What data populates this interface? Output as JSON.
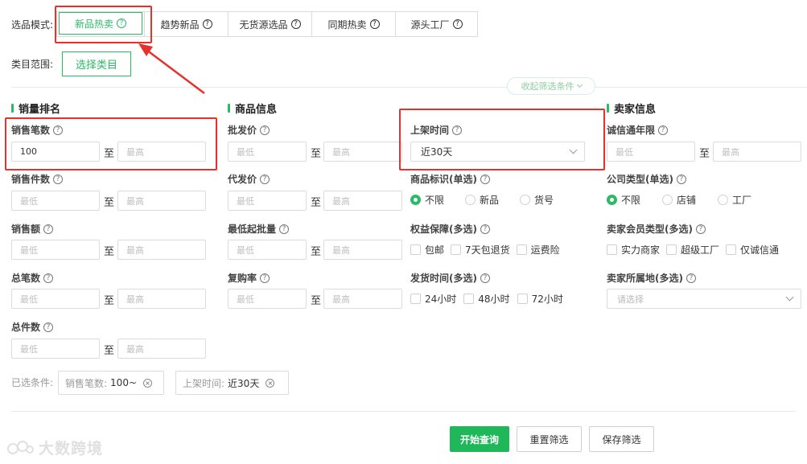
{
  "mode": {
    "label": "选品模式:",
    "tabs": [
      {
        "label": "新品热卖",
        "active": true
      },
      {
        "label": "趋势新品",
        "active": false
      },
      {
        "label": "无货源选品",
        "active": false
      },
      {
        "label": "同期热卖",
        "active": false
      },
      {
        "label": "源头工厂",
        "active": false
      }
    ]
  },
  "category": {
    "label": "类目范围:",
    "button": "选择类目"
  },
  "collapse_label": "收起筛选条件",
  "sections": {
    "sales": {
      "title": "销量排名",
      "fields": [
        {
          "label": "销售笔数",
          "min": "100",
          "max_placeholder": "最高"
        },
        {
          "label": "销售件数",
          "min_placeholder": "最低",
          "max_placeholder": "最高"
        },
        {
          "label": "销售额",
          "min_placeholder": "最低",
          "max_placeholder": "最高"
        },
        {
          "label": "总笔数",
          "min_placeholder": "最低",
          "max_placeholder": "最高"
        },
        {
          "label": "总件数",
          "min_placeholder": "最低",
          "max_placeholder": "最高"
        }
      ]
    },
    "product": {
      "title": "商品信息",
      "fields": [
        {
          "label": "批发价",
          "min_placeholder": "最低",
          "max_placeholder": "最高"
        },
        {
          "label": "代发价",
          "min_placeholder": "最低",
          "max_placeholder": "最高"
        },
        {
          "label": "最低起批量",
          "min_placeholder": "最低",
          "max_placeholder": "最高"
        },
        {
          "label": "复购率",
          "min_placeholder": "最低",
          "max_placeholder": "最高"
        }
      ],
      "listing_time": {
        "label": "上架时间",
        "value": "近30天"
      },
      "product_tag": {
        "label": "商品标识(单选)",
        "options": [
          "不限",
          "新品",
          "货号"
        ],
        "selected": "不限"
      },
      "guarantee": {
        "label": "权益保障(多选)",
        "options": [
          "包邮",
          "7天包退货",
          "运费险"
        ]
      },
      "ship_time": {
        "label": "发货时间(多选)",
        "options": [
          "24小时",
          "48小时",
          "72小时"
        ]
      }
    },
    "seller": {
      "title": "卖家信息",
      "years": {
        "label": "诚信通年限",
        "min_placeholder": "最低",
        "max_placeholder": "最高"
      },
      "company_type": {
        "label": "公司类型(单选)",
        "options": [
          "不限",
          "店铺",
          "工厂"
        ],
        "selected": "不限"
      },
      "member_type": {
        "label": "卖家会员类型(多选)",
        "options": [
          "实力商家",
          "超级工厂",
          "仅诚信通"
        ]
      },
      "location": {
        "label": "卖家所属地(多选)",
        "placeholder": "请选择"
      }
    }
  },
  "range_to": "至",
  "selected_conditions": {
    "label": "已选条件:",
    "chips": [
      {
        "key": "销售笔数:",
        "value": "100~"
      },
      {
        "key": "上架时间:",
        "value": "近30天"
      }
    ]
  },
  "actions": {
    "search": "开始查询",
    "reset": "重置筛选",
    "save": "保存筛选"
  },
  "watermark": "大数跨境",
  "colors": {
    "accent": "#2bbb66",
    "primary_button": "#20b65a",
    "highlight": "#e5322d"
  }
}
